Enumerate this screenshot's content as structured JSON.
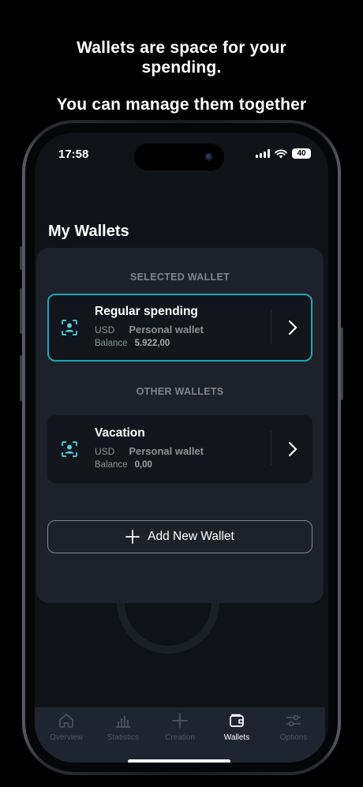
{
  "headline": {
    "line1": "Wallets are space for your spending.",
    "line2": "You can manage them together"
  },
  "status_bar": {
    "time": "17:58",
    "battery": "40",
    "icons": [
      "signal-icon",
      "wifi-icon",
      "battery-icon"
    ]
  },
  "page": {
    "title": "My Wallets"
  },
  "sections": {
    "selected": "SELECTED WALLET",
    "other": "OTHER WALLETS"
  },
  "wallets": [
    {
      "name": "Regular spending",
      "currency": "USD",
      "type": "Personal wallet",
      "balance_label": "Balance",
      "balance": "5.922,00",
      "selected": true,
      "icon": "wallet-user-icon"
    },
    {
      "name": "Vacation",
      "currency": "USD",
      "type": "Personal wallet",
      "balance_label": "Balance",
      "balance": "0,00",
      "selected": false,
      "icon": "wallet-user-icon"
    }
  ],
  "add_button": {
    "label": "Add New Wallet",
    "icon": "plus-icon"
  },
  "tabs": [
    {
      "label": "Overview",
      "icon": "home-icon",
      "active": false
    },
    {
      "label": "Statistics",
      "icon": "bar-chart-icon",
      "active": false
    },
    {
      "label": "Creation",
      "icon": "plus-icon",
      "active": false
    },
    {
      "label": "Wallets",
      "icon": "wallet-icon",
      "active": true
    },
    {
      "label": "Options",
      "icon": "sliders-icon",
      "active": false
    }
  ],
  "colors": {
    "background": "#000000",
    "screen": "#0f1318",
    "sheet": "#1d222a",
    "card": "#12161c",
    "accent": "#1ea3b5",
    "icon_accent": "#4fd1e0",
    "tabbar": "#1e2530"
  }
}
